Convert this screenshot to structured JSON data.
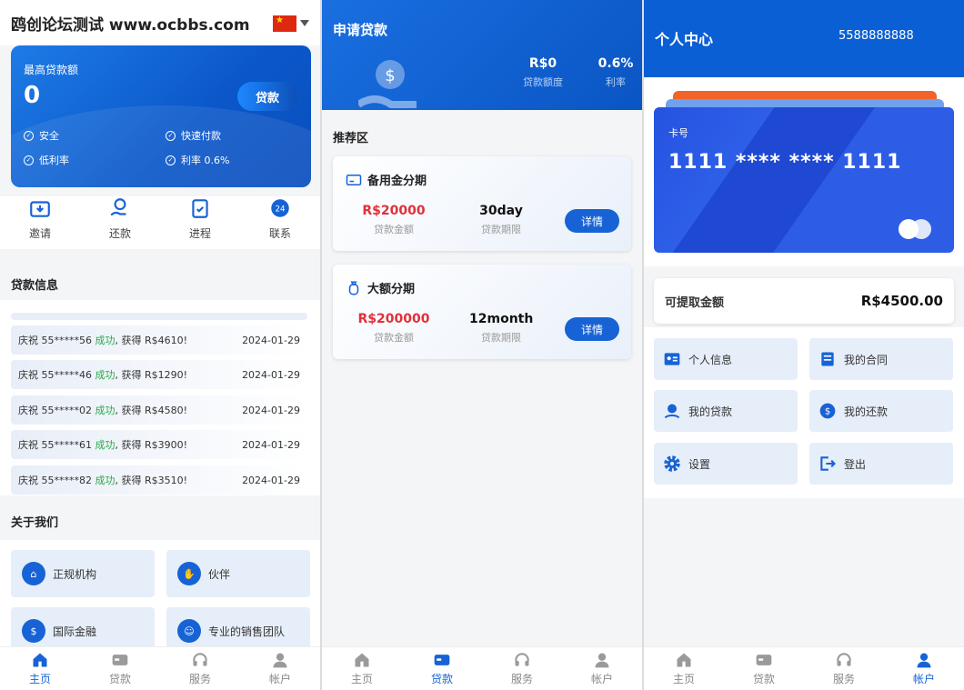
{
  "p1": {
    "title": "鸥创论坛测试 www.ocbbs.com",
    "card": {
      "label": "最高贷款额",
      "amount": "0",
      "button": "贷款",
      "features": [
        "安全",
        "快速付款",
        "低利率",
        "利率 0.6%"
      ]
    },
    "quick": [
      "邀请",
      "还款",
      "进程",
      "联系"
    ],
    "loan_title": "贷款信息",
    "loans": [
      {
        "pre": "庆祝 55*****56 ",
        "ok": "成功",
        "post": ", 获得 R$4610!",
        "date": "2024-01-29"
      },
      {
        "pre": "庆祝 55*****46 ",
        "ok": "成功",
        "post": ", 获得 R$1290!",
        "date": "2024-01-29"
      },
      {
        "pre": "庆祝 55*****02 ",
        "ok": "成功",
        "post": ", 获得 R$4580!",
        "date": "2024-01-29"
      },
      {
        "pre": "庆祝 55*****61 ",
        "ok": "成功",
        "post": ", 获得 R$3900!",
        "date": "2024-01-29"
      },
      {
        "pre": "庆祝 55*****82 ",
        "ok": "成功",
        "post": ", 获得 R$3510!",
        "date": "2024-01-29"
      }
    ],
    "about_title": "关于我们",
    "about": [
      "正规机构",
      "伙伴",
      "国际金融",
      "专业的销售团队"
    ]
  },
  "p2": {
    "title": "申请贷款",
    "stats": [
      {
        "value": "R$0",
        "label": "贷款额度"
      },
      {
        "value": "0.6%",
        "label": "利率"
      }
    ],
    "rec_title": "推荐区",
    "products": [
      {
        "name": "备用金分期",
        "amount": "R$20000",
        "amount_label": "贷款金额",
        "term": "30day",
        "term_label": "贷款期限",
        "button": "详情"
      },
      {
        "name": "大额分期",
        "amount": "R$200000",
        "amount_label": "贷款金额",
        "term": "12month",
        "term_label": "贷款期限",
        "button": "详情"
      }
    ]
  },
  "p3": {
    "title": "个人中心",
    "phone": "5588888888",
    "card_label": "卡号",
    "card_number": "1111 **** **** 1111",
    "withdraw_label": "可提取金额",
    "withdraw_value": "R$4500.00",
    "menu": [
      "个人信息",
      "我的合同",
      "我的贷款",
      "我的还款",
      "设置",
      "登出"
    ]
  },
  "tabs": [
    "主页",
    "贷款",
    "服务",
    "帐户"
  ],
  "colors": {
    "primary": "#1763d6",
    "success": "#2aa84a",
    "danger": "#e0313b"
  }
}
